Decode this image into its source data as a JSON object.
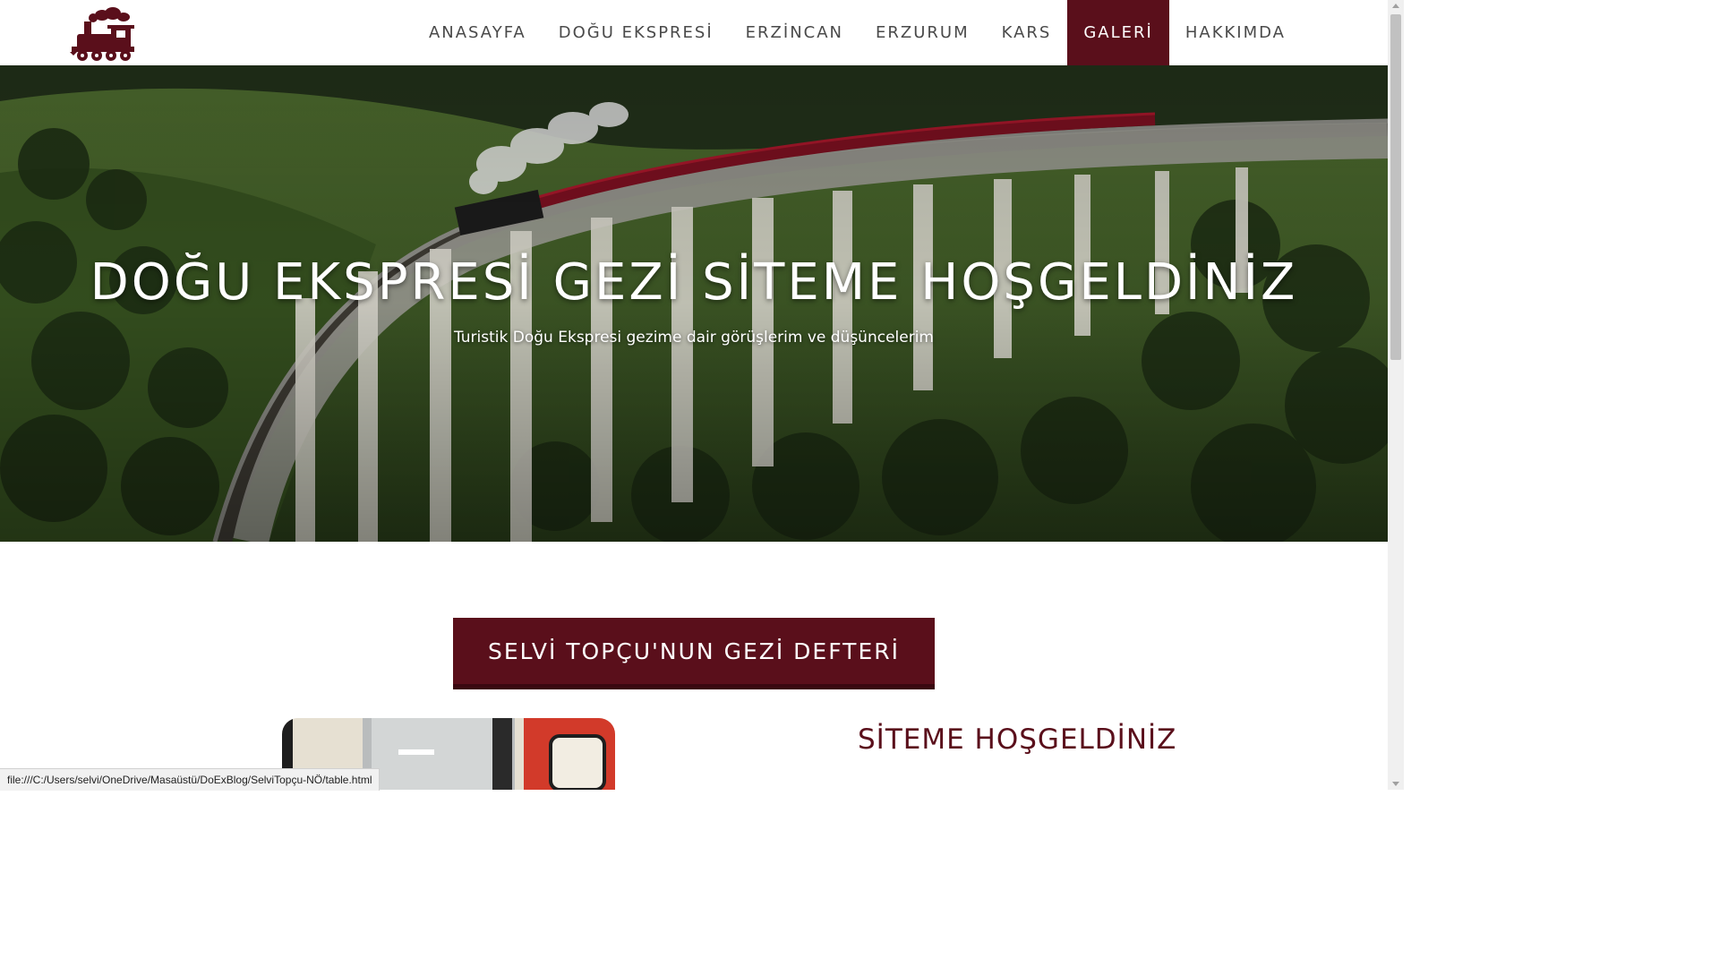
{
  "nav": {
    "items": [
      {
        "label": "ANASAYFA",
        "active": false
      },
      {
        "label": "DOĞU EKSPRESİ",
        "active": false
      },
      {
        "label": "ERZİNCAN",
        "active": false
      },
      {
        "label": "ERZURUM",
        "active": false
      },
      {
        "label": "KARS",
        "active": false
      },
      {
        "label": "GALERİ",
        "active": true
      },
      {
        "label": "HAKKIMDA",
        "active": false
      }
    ],
    "logo_icon": "steam-train-icon"
  },
  "hero": {
    "title": "DOĞU EKSPRESİ GEZİ SİTEME HOŞGELDİNİZ",
    "subtitle": "Turistik Doğu Ekspresi gezime dair görüşlerim ve düşüncelerim"
  },
  "section": {
    "title": "SELVİ TOPÇU'NUN GEZİ DEFTERİ",
    "welcome": "SİTEME HOŞGELDİNİZ"
  },
  "status_bar": {
    "url": "file:///C:/Users/selvi/OneDrive/Masaüstü/DoExBlog/SelviTopçu-NÖ/table.html"
  },
  "colors": {
    "accent": "#5a0f1b",
    "nav_text": "#4a4a4a"
  }
}
